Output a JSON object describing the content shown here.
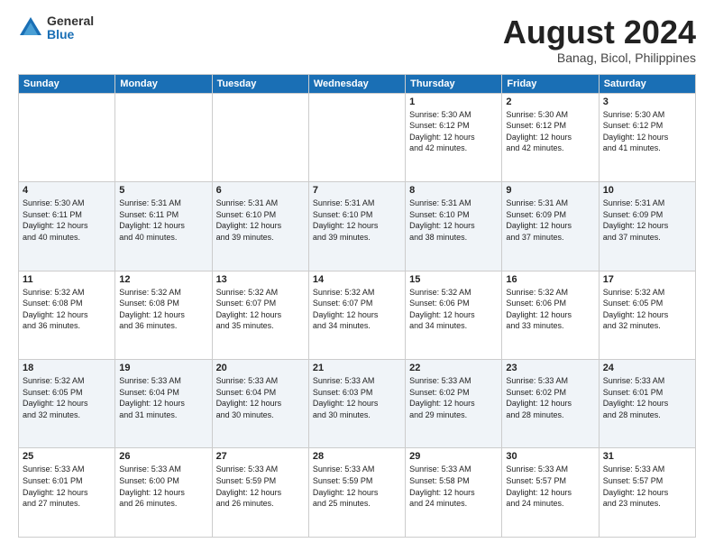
{
  "logo": {
    "general": "General",
    "blue": "Blue"
  },
  "header": {
    "month_year": "August 2024",
    "location": "Banag, Bicol, Philippines"
  },
  "days_of_week": [
    "Sunday",
    "Monday",
    "Tuesday",
    "Wednesday",
    "Thursday",
    "Friday",
    "Saturday"
  ],
  "weeks": [
    [
      {
        "day": "",
        "info": ""
      },
      {
        "day": "",
        "info": ""
      },
      {
        "day": "",
        "info": ""
      },
      {
        "day": "",
        "info": ""
      },
      {
        "day": "1",
        "info": "Sunrise: 5:30 AM\nSunset: 6:12 PM\nDaylight: 12 hours\nand 42 minutes."
      },
      {
        "day": "2",
        "info": "Sunrise: 5:30 AM\nSunset: 6:12 PM\nDaylight: 12 hours\nand 42 minutes."
      },
      {
        "day": "3",
        "info": "Sunrise: 5:30 AM\nSunset: 6:12 PM\nDaylight: 12 hours\nand 41 minutes."
      }
    ],
    [
      {
        "day": "4",
        "info": "Sunrise: 5:30 AM\nSunset: 6:11 PM\nDaylight: 12 hours\nand 40 minutes."
      },
      {
        "day": "5",
        "info": "Sunrise: 5:31 AM\nSunset: 6:11 PM\nDaylight: 12 hours\nand 40 minutes."
      },
      {
        "day": "6",
        "info": "Sunrise: 5:31 AM\nSunset: 6:10 PM\nDaylight: 12 hours\nand 39 minutes."
      },
      {
        "day": "7",
        "info": "Sunrise: 5:31 AM\nSunset: 6:10 PM\nDaylight: 12 hours\nand 39 minutes."
      },
      {
        "day": "8",
        "info": "Sunrise: 5:31 AM\nSunset: 6:10 PM\nDaylight: 12 hours\nand 38 minutes."
      },
      {
        "day": "9",
        "info": "Sunrise: 5:31 AM\nSunset: 6:09 PM\nDaylight: 12 hours\nand 37 minutes."
      },
      {
        "day": "10",
        "info": "Sunrise: 5:31 AM\nSunset: 6:09 PM\nDaylight: 12 hours\nand 37 minutes."
      }
    ],
    [
      {
        "day": "11",
        "info": "Sunrise: 5:32 AM\nSunset: 6:08 PM\nDaylight: 12 hours\nand 36 minutes."
      },
      {
        "day": "12",
        "info": "Sunrise: 5:32 AM\nSunset: 6:08 PM\nDaylight: 12 hours\nand 36 minutes."
      },
      {
        "day": "13",
        "info": "Sunrise: 5:32 AM\nSunset: 6:07 PM\nDaylight: 12 hours\nand 35 minutes."
      },
      {
        "day": "14",
        "info": "Sunrise: 5:32 AM\nSunset: 6:07 PM\nDaylight: 12 hours\nand 34 minutes."
      },
      {
        "day": "15",
        "info": "Sunrise: 5:32 AM\nSunset: 6:06 PM\nDaylight: 12 hours\nand 34 minutes."
      },
      {
        "day": "16",
        "info": "Sunrise: 5:32 AM\nSunset: 6:06 PM\nDaylight: 12 hours\nand 33 minutes."
      },
      {
        "day": "17",
        "info": "Sunrise: 5:32 AM\nSunset: 6:05 PM\nDaylight: 12 hours\nand 32 minutes."
      }
    ],
    [
      {
        "day": "18",
        "info": "Sunrise: 5:32 AM\nSunset: 6:05 PM\nDaylight: 12 hours\nand 32 minutes."
      },
      {
        "day": "19",
        "info": "Sunrise: 5:33 AM\nSunset: 6:04 PM\nDaylight: 12 hours\nand 31 minutes."
      },
      {
        "day": "20",
        "info": "Sunrise: 5:33 AM\nSunset: 6:04 PM\nDaylight: 12 hours\nand 30 minutes."
      },
      {
        "day": "21",
        "info": "Sunrise: 5:33 AM\nSunset: 6:03 PM\nDaylight: 12 hours\nand 30 minutes."
      },
      {
        "day": "22",
        "info": "Sunrise: 5:33 AM\nSunset: 6:02 PM\nDaylight: 12 hours\nand 29 minutes."
      },
      {
        "day": "23",
        "info": "Sunrise: 5:33 AM\nSunset: 6:02 PM\nDaylight: 12 hours\nand 28 minutes."
      },
      {
        "day": "24",
        "info": "Sunrise: 5:33 AM\nSunset: 6:01 PM\nDaylight: 12 hours\nand 28 minutes."
      }
    ],
    [
      {
        "day": "25",
        "info": "Sunrise: 5:33 AM\nSunset: 6:01 PM\nDaylight: 12 hours\nand 27 minutes."
      },
      {
        "day": "26",
        "info": "Sunrise: 5:33 AM\nSunset: 6:00 PM\nDaylight: 12 hours\nand 26 minutes."
      },
      {
        "day": "27",
        "info": "Sunrise: 5:33 AM\nSunset: 5:59 PM\nDaylight: 12 hours\nand 26 minutes."
      },
      {
        "day": "28",
        "info": "Sunrise: 5:33 AM\nSunset: 5:59 PM\nDaylight: 12 hours\nand 25 minutes."
      },
      {
        "day": "29",
        "info": "Sunrise: 5:33 AM\nSunset: 5:58 PM\nDaylight: 12 hours\nand 24 minutes."
      },
      {
        "day": "30",
        "info": "Sunrise: 5:33 AM\nSunset: 5:57 PM\nDaylight: 12 hours\nand 24 minutes."
      },
      {
        "day": "31",
        "info": "Sunrise: 5:33 AM\nSunset: 5:57 PM\nDaylight: 12 hours\nand 23 minutes."
      }
    ]
  ]
}
